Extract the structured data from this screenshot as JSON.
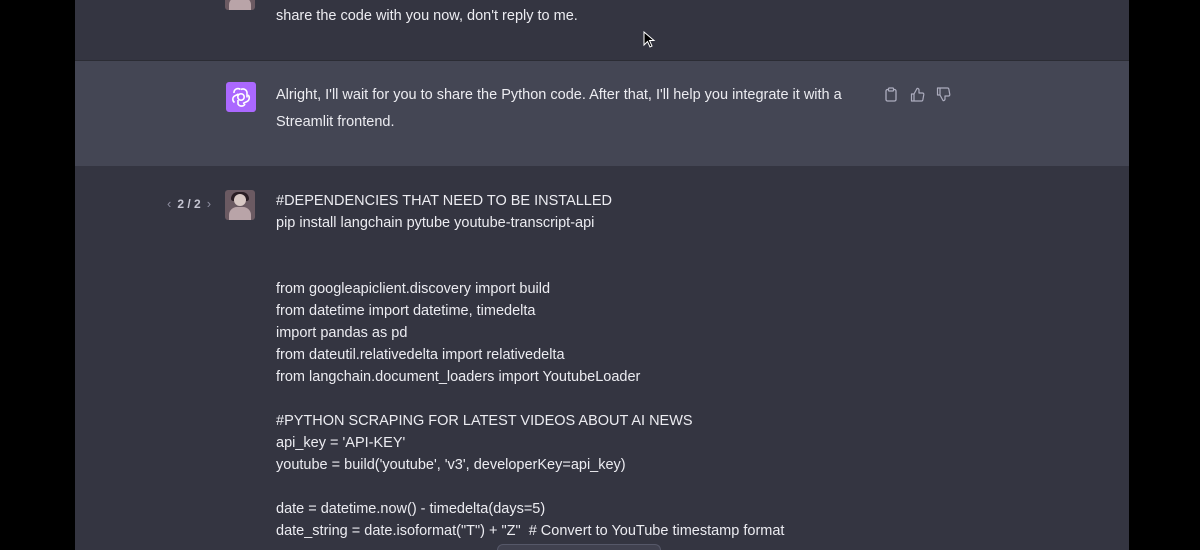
{
  "user_message_1": {
    "text": "share the code with you now, don't reply to me."
  },
  "assistant_message": {
    "lines": [
      "Alright, I'll wait for you to share the Python code. After that, I'll help you integrate it with a",
      "Streamlit frontend."
    ],
    "actions": [
      "clipboard-icon",
      "thumbs-up-icon",
      "thumbs-down-icon"
    ]
  },
  "user_message_2": {
    "pager": {
      "label": "2 / 2"
    },
    "code_lines": [
      "#DEPENDENCIES THAT NEED TO BE INSTALLED",
      "pip install langchain pytube youtube-transcript-api",
      "",
      "",
      "from googleapiclient.discovery import build",
      "from datetime import datetime, timedelta",
      "import pandas as pd",
      "from dateutil.relativedelta import relativedelta",
      "from langchain.document_loaders import YoutubeLoader",
      "",
      "#PYTHON SCRAPING FOR LATEST VIDEOS ABOUT AI NEWS",
      "api_key = 'API-KEY'",
      "youtube = build('youtube', 'v3', developerKey=api_key)",
      "",
      "date = datetime.now() - timedelta(days=5)",
      "date_string = date.isoformat(\"T\") + \"Z\"  # Convert to YouTube timestamp format"
    ]
  },
  "colors": {
    "user_bg": "#343541",
    "assistant_bg": "#444654",
    "gpt_avatar": "#ab68ff",
    "text": "#ececf1"
  }
}
